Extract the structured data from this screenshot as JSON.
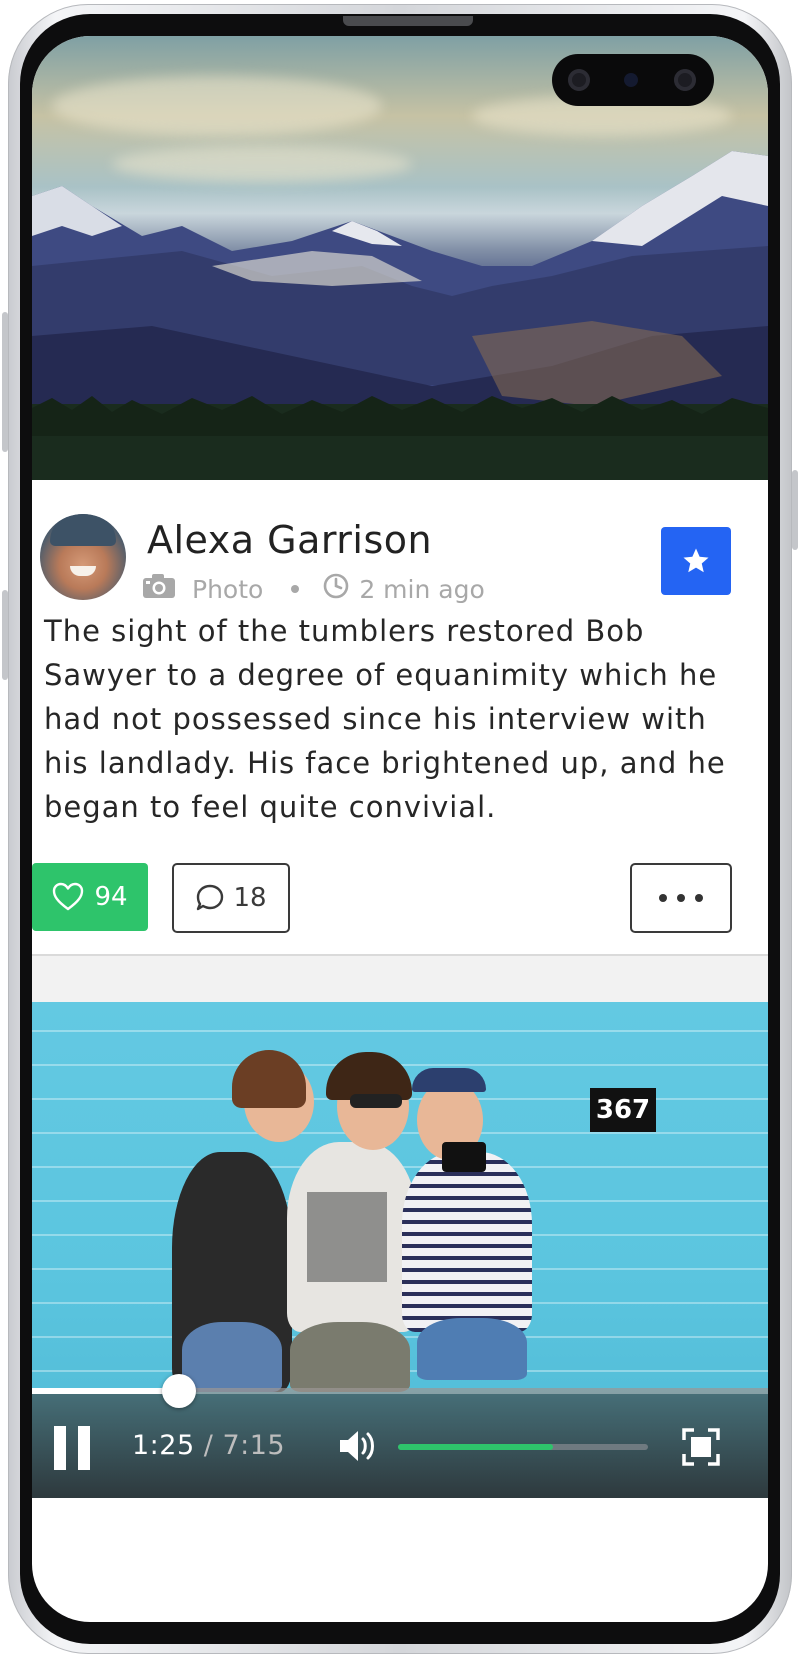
{
  "post": {
    "author": "Alexa Garrison",
    "type": "Photo",
    "time": "2 min ago",
    "text": "The sight of the tumblers restored Bob Sawyer to a degree of equanimity which he had not possessed since his interview with his landlady. His face brightened up, and he began to feel quite convivial."
  },
  "actions": {
    "likes": "94",
    "comments": "18"
  },
  "video": {
    "current_time": "1:25",
    "separator": "/",
    "total_time": "7:15",
    "progress": 0.2,
    "volume": 0.62,
    "sign_number": "367"
  },
  "colors": {
    "favorite_button": "#2464f3",
    "like_button": "#2ec46b",
    "volume_fill": "#2ec46b"
  },
  "icons": [
    "camera-icon",
    "clock-icon",
    "star-icon",
    "heart-icon",
    "comment-icon",
    "more-icon",
    "pause-icon",
    "volume-icon",
    "fullscreen-icon"
  ]
}
